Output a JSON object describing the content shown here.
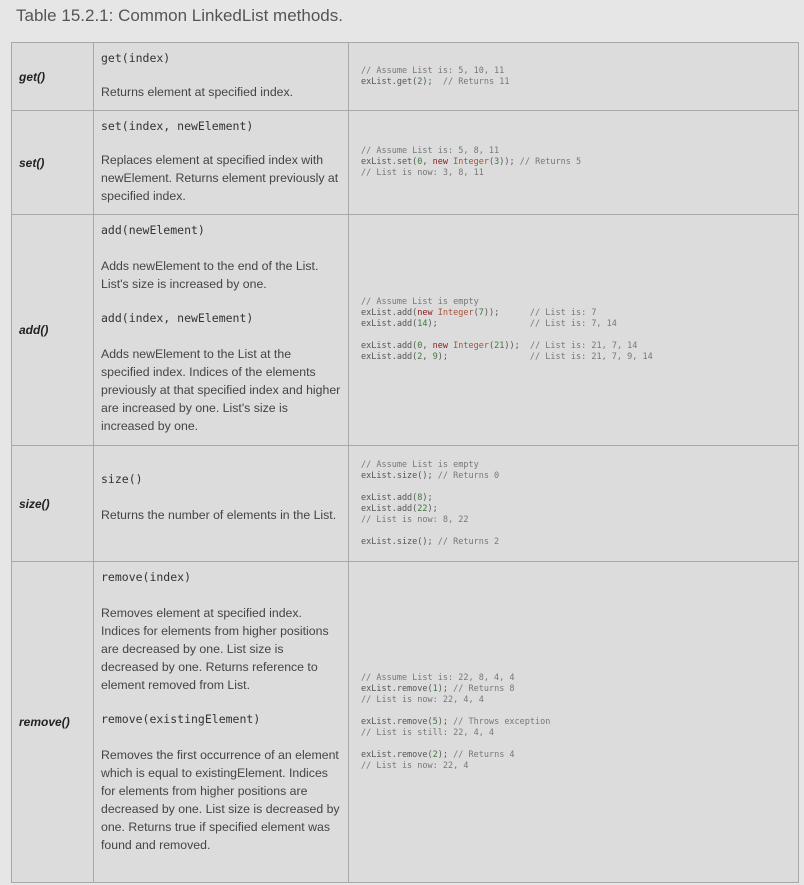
{
  "caption": "Table 15.2.1: Common LinkedList methods.",
  "rows": [
    {
      "name": "get()",
      "sig1": "get(index)",
      "desc1": "Returns element at specified index.",
      "code": [
        "// Assume List is: 5, 10, 11",
        "exList.get(2);  // Returns 11"
      ]
    },
    {
      "name": "set()",
      "sig1": "set(index, newElement)",
      "desc1": "Replaces element at specified index with newElement. Returns element previously at specified index.",
      "code": [
        "// Assume List is: 5, 8, 11",
        "exList.set(0, new Integer(3)); // Returns 5",
        "// List is now: 3, 8, 11"
      ]
    },
    {
      "name": "add()",
      "sig1": "add(newElement)",
      "desc1": "Adds newElement to the end of the List. List's size is increased by one.",
      "sig2": "add(index, newElement)",
      "desc2": "Adds newElement to the List at the specified index. Indices of the elements previously at that specified index and higher are increased by one. List's size is increased by one.",
      "code": [
        "// Assume List is empty",
        "exList.add(new Integer(7));      // List is: 7",
        "exList.add(14);                  // List is: 7, 14",
        "",
        "exList.add(0, new Integer(21));  // List is: 21, 7, 14",
        "exList.add(2, 9);                // List is: 21, 7, 9, 14"
      ]
    },
    {
      "name": "size()",
      "sig1": "size()",
      "desc1": "Returns the number of elements in the List.",
      "code": [
        "// Assume List is empty",
        "exList.size(); // Returns 0",
        "",
        "exList.add(8);",
        "exList.add(22);",
        "// List is now: 8, 22",
        "",
        "exList.size(); // Returns 2"
      ]
    },
    {
      "name": "remove()",
      "sig1": "remove(index)",
      "desc1": "Removes element at specified index. Indices for elements from higher positions are decreased by one. List size is decreased by one. Returns reference to element removed from List.",
      "sig2": "remove(existingElement)",
      "desc2": "Removes the first occurrence of an element which is equal to existingElement. Indices for elements from higher positions are decreased by one. List size is decreased by one. Returns true if specified element was found and removed.",
      "code": [
        "// Assume List is: 22, 8, 4, 4",
        "exList.remove(1); // Returns 8",
        "// List is now: 22, 4, 4",
        "",
        "exList.remove(5); // Throws exception",
        "// List is still: 22, 4, 4",
        "",
        "exList.remove(2); // Returns 4",
        "// List is now: 22, 4"
      ]
    }
  ]
}
